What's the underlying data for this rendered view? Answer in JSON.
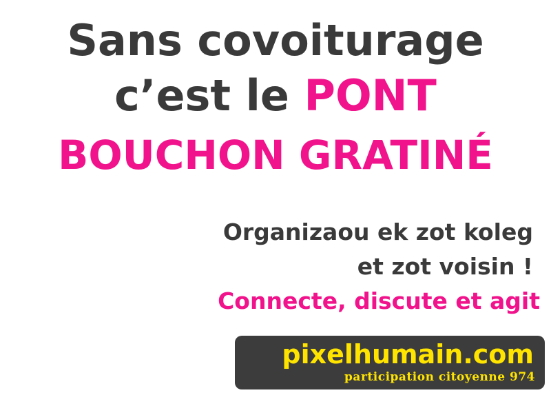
{
  "headline": {
    "line1": "Sans covoiturage",
    "line2_prefix": "c’est le ",
    "line2_highlight": "PONT",
    "line3": "BOUCHON GRATINÉ"
  },
  "subtext": {
    "line1": "Organizaou ek zot koleg",
    "line2": "et zot voisin !",
    "line3": "Connecte, discute et agit"
  },
  "badge": {
    "url": "pixelhumain.com",
    "tagline": "participation citoyenne 974"
  },
  "colors": {
    "dark_text": "#3a3a3a",
    "accent_pink": "#f0138c",
    "badge_bg": "#3c3c3c",
    "badge_text": "#ffe400"
  }
}
